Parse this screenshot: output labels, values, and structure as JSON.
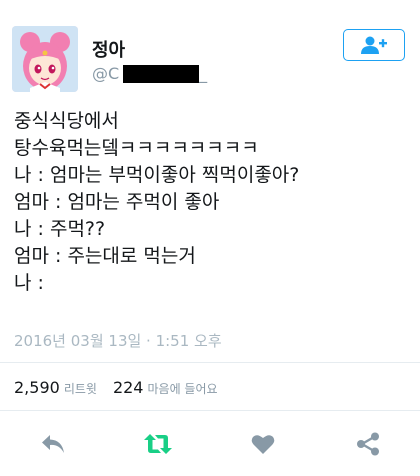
{
  "profile": {
    "display_name": "정아",
    "handle_prefix": "@C",
    "handle_suffix": "_"
  },
  "follow_button": {
    "icon": "add-user-icon",
    "color": "#1da1f2"
  },
  "tweet": {
    "lines": [
      "중식식당에서",
      "탕수육먹는뎈ㅋㅋㅋㅋㅋㅋㅋㅋ",
      "나 : 엄마는 부먹이좋아 찍먹이좋아?",
      "엄마 : 엄마는 주먹이 좋아",
      "나 : 주먹??",
      "엄마 : 주는대로 먹는거",
      "나 :"
    ],
    "timestamp": "2016년 03월 13일 · 1:51 오후"
  },
  "stats": {
    "retweets_count": "2,590",
    "retweets_label": "리트윗",
    "likes_count": "224",
    "likes_label": "마음에 들어요"
  },
  "actions": {
    "reply_icon": "reply-icon",
    "retweet_icon": "retweet-icon",
    "like_icon": "heart-icon",
    "share_icon": "share-icon",
    "icon_color": "#8899a6",
    "retweet_active_color": "#19cf86"
  }
}
